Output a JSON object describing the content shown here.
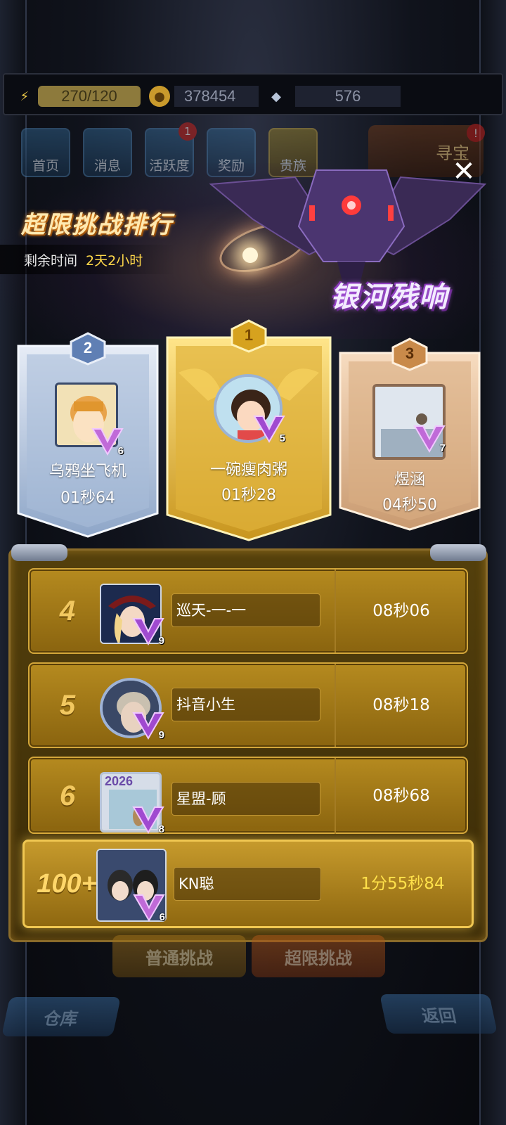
{
  "resources": {
    "energy": "270/120",
    "gold": "378454",
    "gems": "576"
  },
  "nav": {
    "home": "首页",
    "messages": "消息",
    "activity": "活跃度",
    "activity_badge": "1",
    "rewards": "奖励",
    "vip": "贵族",
    "treasure": "寻宝",
    "treasure_badge": "!"
  },
  "banner": {
    "title": "超限挑战排行",
    "remaining_label": "剩余时间",
    "remaining_value": "2天2小时",
    "event_name": "银河残响"
  },
  "podium": [
    {
      "rank": "1",
      "name": "一碗瘦肉粥",
      "time": "01秒28",
      "vip": "5"
    },
    {
      "rank": "2",
      "name": "乌鸦坐飞机",
      "time": "01秒64",
      "vip": "6"
    },
    {
      "rank": "3",
      "name": "煜涵",
      "time": "04秒50",
      "vip": "7"
    }
  ],
  "list": [
    {
      "rank": "4",
      "name": "巡天-一-一",
      "time": "08秒06",
      "vip": "9"
    },
    {
      "rank": "5",
      "name": "抖音小生",
      "time": "08秒18",
      "vip": "9"
    },
    {
      "rank": "6",
      "name": "星盟-顾",
      "time": "08秒68",
      "vip": "8",
      "frame_text": "2026"
    }
  ],
  "me": {
    "rank": "100+",
    "name": "KN聪",
    "time": "1分55秒84",
    "vip": "6"
  },
  "bottom": {
    "normal": "普通挑战",
    "extreme": "超限挑战",
    "warehouse": "仓库",
    "back": "返回"
  },
  "colors": {
    "gold_accent": "#f2c860",
    "highlight_text": "#ffe14a",
    "event_purple": "#c46cff"
  }
}
